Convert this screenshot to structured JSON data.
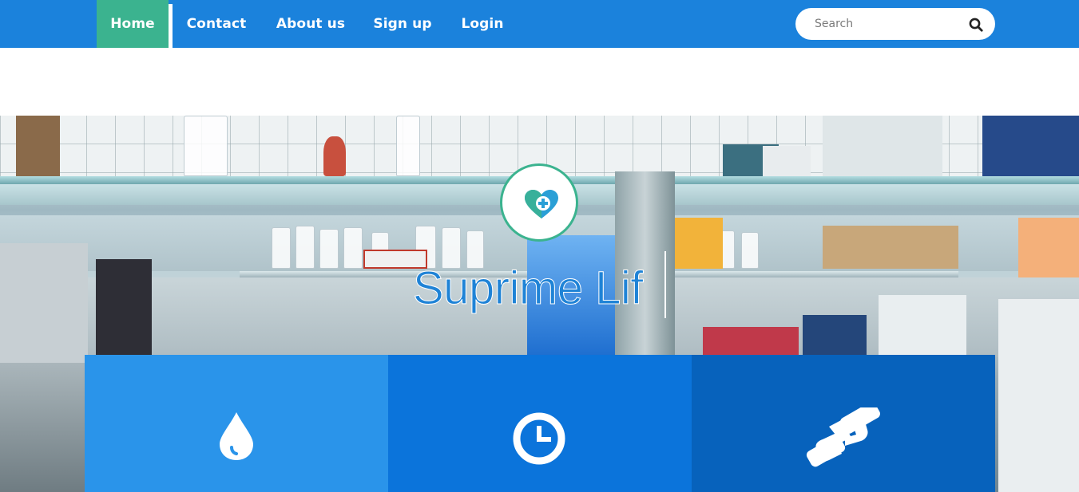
{
  "nav": {
    "items": [
      {
        "label": "Home",
        "active": true
      },
      {
        "label": "Contact",
        "active": false
      },
      {
        "label": "About us",
        "active": false
      },
      {
        "label": "Sign up",
        "active": false
      },
      {
        "label": "Login",
        "active": false
      }
    ],
    "search_placeholder": "Search",
    "search_icon": "search-icon"
  },
  "hero": {
    "title": "Suprime Lif",
    "logo_icon": "heart-plus-icon"
  },
  "features": [
    {
      "icon": "water-drop-icon",
      "color": "#2a94ea"
    },
    {
      "icon": "clock-icon",
      "color": "#0b74db"
    },
    {
      "icon": "handshake-icon",
      "color": "#0762bc"
    }
  ],
  "colors": {
    "nav_bg": "#1b82dc",
    "nav_active": "#3bb38f",
    "title": "#1f83d6"
  }
}
